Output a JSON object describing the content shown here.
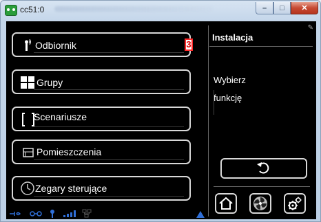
{
  "window": {
    "title": "cc51:0",
    "minimize_glyph": "–",
    "maximize_glyph": "□",
    "close_glyph": "✕"
  },
  "menu": [
    {
      "label": "Odbiornik",
      "icon": "remote-icon",
      "badge": "3"
    },
    {
      "label": "Grupy",
      "icon": "grid-icon"
    },
    {
      "label": "Scenariusze",
      "icon": "bracket-icon"
    },
    {
      "label": "Pomieszczenia",
      "icon": "room-icon"
    },
    {
      "label": "Zegary sterujące",
      "icon": "clock-icon"
    }
  ],
  "right_panel": {
    "title": "Instalacja",
    "text_line1": "Wybierz",
    "text_line2": "funkcję",
    "back_icon": "back-arrow-icon",
    "bottom_icons": [
      "home-icon",
      "fan-icon",
      "settings-gear-icon"
    ]
  },
  "status_bar": {
    "icons": [
      "connection-icon",
      "link-icon",
      "antenna-icon",
      "signal-bars-icon",
      "network-icon",
      "up-arrow-icon"
    ]
  },
  "colors": {
    "screen_bg": "#000000",
    "button_border": "#d8d8d8",
    "status_blue": "#2f6fd8",
    "badge_red": "#ff2a2a"
  }
}
